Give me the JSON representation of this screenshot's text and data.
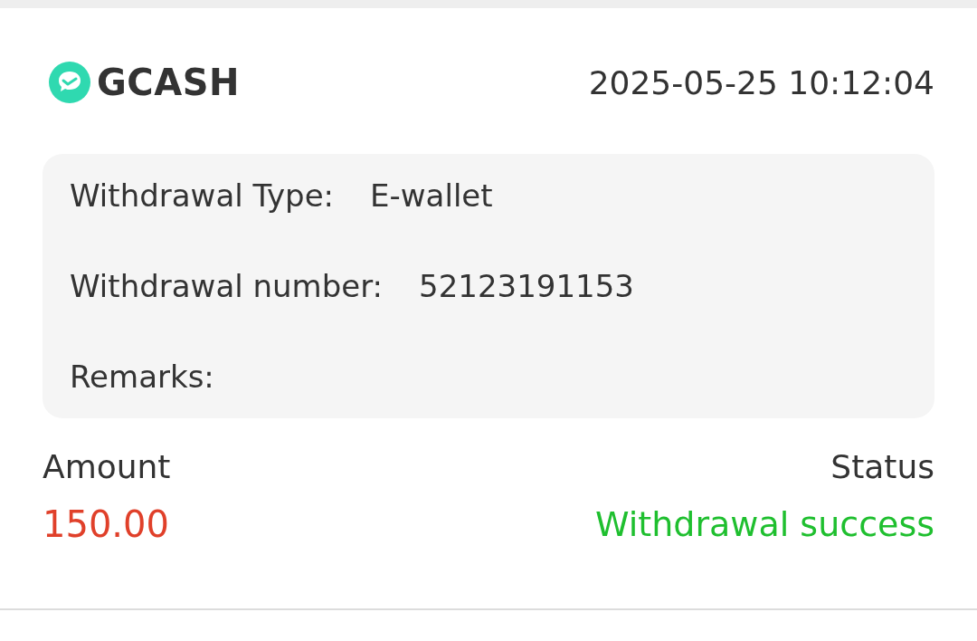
{
  "record": {
    "provider": "GCASH",
    "datetime": "2025-05-25 10:12:04",
    "details": [
      {
        "label": "Withdrawal Type:",
        "value": "E-wallet"
      },
      {
        "label": "Withdrawal number:",
        "value": "52123191153"
      },
      {
        "label": "Remarks:"
      }
    ],
    "amount": {
      "label": "Amount",
      "value": "150.00"
    },
    "status": {
      "label": "Status",
      "value": "Withdrawal success",
      "kind": "success"
    }
  }
}
